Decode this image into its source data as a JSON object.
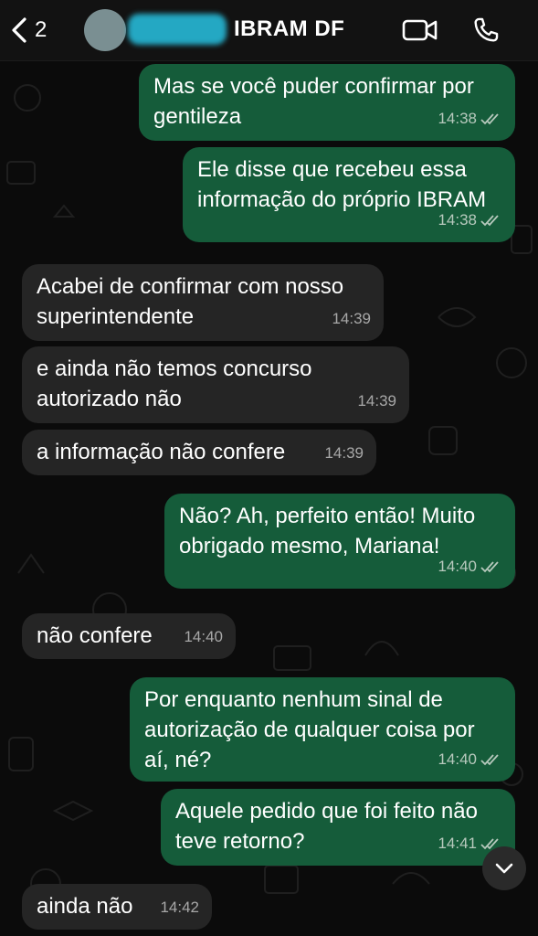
{
  "header": {
    "back_count": "2",
    "contact_name": "IBRAM DF"
  },
  "messages": [
    {
      "dir": "out",
      "text": "Mas se você puder confirmar por\ngentileza",
      "time": "14:38",
      "read": true
    },
    {
      "dir": "out",
      "text": "Ele disse que recebeu essa\ninformação do próprio IBRAM",
      "time": "14:38",
      "read": true
    },
    {
      "dir": "in",
      "text": "Acabei de confirmar com nosso\nsuperintendente",
      "time": "14:39"
    },
    {
      "dir": "in",
      "text": "e ainda não temos concurso\nautorizado não",
      "time": "14:39"
    },
    {
      "dir": "in",
      "text": "a informação não confere",
      "time": "14:39"
    },
    {
      "dir": "out",
      "text": "Não? Ah, perfeito então! Muito\nobrigado mesmo, Mariana!",
      "time": "14:40",
      "read": true
    },
    {
      "dir": "in",
      "text": "não confere",
      "time": "14:40"
    },
    {
      "dir": "out",
      "text": "Por enquanto nenhum sinal de\nautorização de qualquer coisa por\naí, né?",
      "time": "14:40",
      "read": true
    },
    {
      "dir": "out",
      "text": "Aquele pedido que foi feito não\nteve retorno?",
      "time": "14:41",
      "read": true
    },
    {
      "dir": "in",
      "text": "ainda não",
      "time": "14:42"
    }
  ],
  "icons": {
    "back": "chevron-left-icon",
    "video": "video-camera-icon",
    "call": "phone-icon",
    "scroll": "chevron-down-icon",
    "read_receipt": "double-check-icon"
  },
  "colors": {
    "outgoing_bubble": "#155c3a",
    "incoming_bubble": "#252525",
    "background": "#0b0b0b"
  }
}
